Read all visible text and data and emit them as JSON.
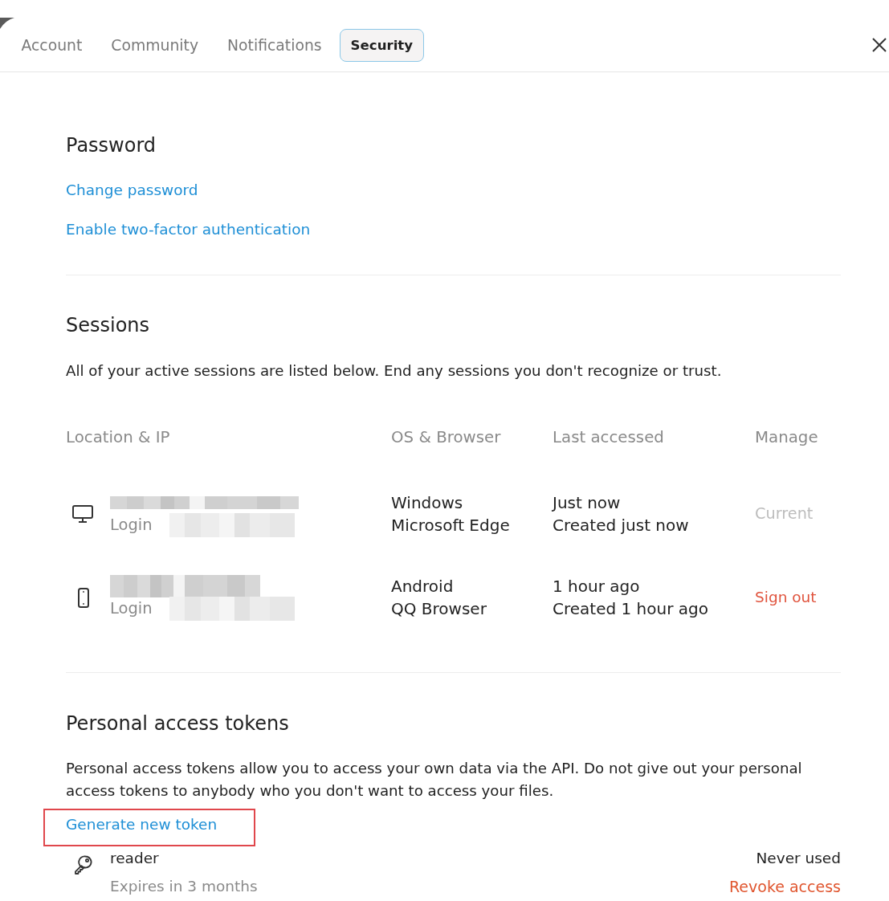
{
  "tabs": [
    {
      "label": "Account",
      "selected": false
    },
    {
      "label": "Community",
      "selected": false
    },
    {
      "label": "Notifications",
      "selected": false
    },
    {
      "label": "Security",
      "selected": true
    }
  ],
  "password": {
    "title": "Password",
    "links": [
      "Change password",
      "Enable two-factor authentication"
    ]
  },
  "sessions": {
    "title": "Sessions",
    "description": "All of your active sessions are listed below. End any sessions you don't recognize or trust.",
    "columns": [
      "Location & IP",
      "OS & Browser",
      "Last accessed",
      "Manage"
    ],
    "rows": [
      {
        "kind": "desktop",
        "location_redacted": true,
        "method": "Login",
        "address_redacted": true,
        "os": "Windows",
        "browser": "Microsoft Edge",
        "last_accessed": "Just now",
        "created": "Created just now",
        "manage": {
          "kind": "current",
          "label": "Current"
        }
      },
      {
        "kind": "mobile",
        "location_redacted": true,
        "method": "Login",
        "address_redacted": true,
        "os": "Android",
        "browser": "QQ Browser",
        "last_accessed": "1 hour ago",
        "created": "Created 1 hour ago",
        "manage": {
          "kind": "sign_out",
          "label": "Sign out"
        }
      }
    ]
  },
  "tokens": {
    "title": "Personal access tokens",
    "description": "Personal access tokens allow you to access your own data via the API. Do not give out your personal access tokens to anybody who you don't want to access your files.",
    "generate": {
      "label": "Generate new token",
      "highlighted": true
    },
    "items": [
      {
        "name": "reader",
        "expires": "Expires in 3 months",
        "last_used": "Never used",
        "action": "Revoke access"
      }
    ]
  }
}
